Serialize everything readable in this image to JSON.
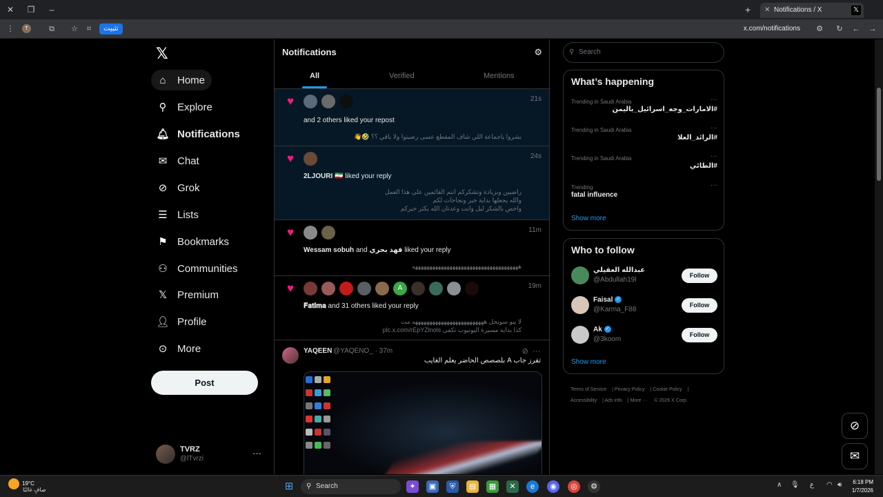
{
  "browser": {
    "tab_title": "Notifications / X",
    "url": "x.com/notifications",
    "pin_label": "تثبيت",
    "profile_initial": "T"
  },
  "nav": {
    "items": [
      {
        "label": "Home",
        "icon": "home-icon"
      },
      {
        "label": "Explore",
        "icon": "search-icon"
      },
      {
        "label": "Notifications",
        "icon": "bell-icon"
      },
      {
        "label": "Chat",
        "icon": "mail-icon"
      },
      {
        "label": "Grok",
        "icon": "grok-icon"
      },
      {
        "label": "Lists",
        "icon": "list-icon"
      },
      {
        "label": "Bookmarks",
        "icon": "bookmark-icon"
      },
      {
        "label": "Communities",
        "icon": "people-icon"
      },
      {
        "label": "Premium",
        "icon": "x-icon"
      },
      {
        "label": "Profile",
        "icon": "person-icon"
      },
      {
        "label": "More",
        "icon": "more-circle-icon"
      }
    ],
    "post_label": "Post",
    "user": {
      "name": "TVRZ",
      "handle": "@lTvrzi"
    }
  },
  "center": {
    "title": "Notifications",
    "tabs": [
      "All",
      "Verified",
      "Mentions"
    ],
    "notifications": [
      {
        "time": "21s",
        "bold": "",
        "text": "and 2 others liked your repost",
        "sub": [
          "بشروا ياجماعة اللي شاف المقطع عسى رضيتوا ولا باقي ؟؟ 🤣👋"
        ]
      },
      {
        "time": "24s",
        "bold": "2LJOURI 🇮🇷",
        "text": "liked your reply",
        "sub": [
          "راضيين وبزيادة وتشكركم انتم القائمين على هذا العمل",
          "والله يجعلها بداية خير ونجاحات لكم",
          "واخص بالشكر ليل  وانت وعدنان الله يكثر خيركم"
        ]
      },
      {
        "time": "11m",
        "bold": "Wessam sobuh",
        "bold2": "فهد بحري",
        "and_word": "and",
        "text": "liked your reply",
        "sub": [
          "هههههههههههههههههههههههههههههههههههههه"
        ]
      },
      {
        "time": "19m",
        "bold": "𝐅𝐚𝐭𝐢𝐦𝐚",
        "text": "and 31 others liked your reply",
        "sub": [
          "لا يبو سويحل هههههههههههههههههههههههههه مت",
          "كذا بداية مسيرة اليوتيوب تكفى plc.x.com/rEpYZlnols"
        ]
      }
    ],
    "tweet": {
      "name": "YAQEEN",
      "handle": "@YAQENO_",
      "time": "· 37m",
      "text": "تفرز جاب A بلصصص الحاضر يعلم الغايب"
    }
  },
  "right": {
    "search_placeholder": "Search",
    "happening_title": "What’s happening",
    "trends": [
      {
        "category": "Trending in Saudi Arabia",
        "name": "#الامارات_وجه_اسرائيل_باليمن"
      },
      {
        "category": "Trending in Saudi Arabia",
        "name": "#الرائد_العلا"
      },
      {
        "category": "Trending in Saudi Arabia",
        "name": "#الطائي"
      },
      {
        "category": "Trending",
        "name": "fatal influence"
      }
    ],
    "show_more": "Show more",
    "follow_title": "Who to follow",
    "follow": [
      {
        "name": "عبدالله العقيلي",
        "handle": "@Abdullah19l",
        "verified": false,
        "button": "Follow"
      },
      {
        "name": "Faisal",
        "handle": "@Karma_F88",
        "verified": true,
        "button": "Follow"
      },
      {
        "name": "Ak",
        "handle": "@3koom",
        "verified": true,
        "button": "Follow"
      }
    ],
    "footer": [
      "Terms of Service",
      "Privacy Policy",
      "Cookie Policy",
      "Accessibility",
      "Ads info",
      "More ···",
      "© 2026 X Corp."
    ]
  },
  "taskbar": {
    "temp": "19°C",
    "weather_desc": "صافٍ غالبًا",
    "search_label": "Search",
    "lang": "ع",
    "time": "6:18 PM",
    "date": "1/7/2026"
  },
  "colors": {
    "accent": "#1d9bf0",
    "like": "#f91880",
    "unread_bg": "#061826"
  }
}
